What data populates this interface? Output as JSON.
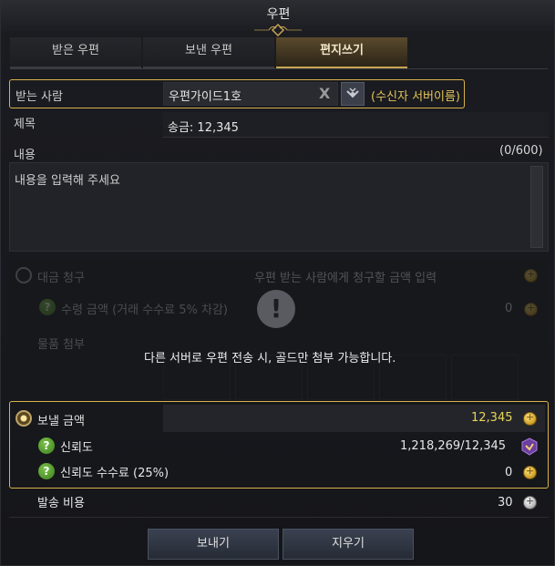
{
  "title": "우편",
  "tabs": [
    {
      "label": "받은 우편"
    },
    {
      "label": "보낸 우편"
    },
    {
      "label": "편지쓰기"
    }
  ],
  "recipient": {
    "label": "받는 사람",
    "value": "우편가이드1호",
    "clear_glyph": "X",
    "server_label": "(수신자 서버이름)"
  },
  "subject": {
    "label": "제목",
    "value": "송금: 12,345"
  },
  "content": {
    "label": "내용",
    "counter": "(0/600)",
    "placeholder": "내용을 입력해 주세요"
  },
  "cod": {
    "label": "대금 청구",
    "placeholder": "우편 받는 사람에게 청구할 금액 입력",
    "received_label": "수령 금액 (거래 수수료 5% 차감)",
    "received_value": "0"
  },
  "attach": {
    "label": "물품 첨부"
  },
  "notice": {
    "icon_glyph": "!",
    "text": "다른 서버로 우편 전송 시, 골드만 첨부 가능합니다."
  },
  "send_amount": {
    "label": "보낼 금액",
    "value": "12,345"
  },
  "trust": {
    "label": "신뢰도",
    "value": "1,218,269/12,345"
  },
  "trust_fee": {
    "label": "신뢰도 수수료 (25%)",
    "value": "0"
  },
  "shipping": {
    "label": "발송 비용",
    "value": "30"
  },
  "buttons": {
    "send": "보내기",
    "clear": "지우기"
  },
  "help_glyph": "?",
  "colors": {
    "accent_gold": "#d6b24a",
    "gold_text": "#e3c25a",
    "trust_icon": "#6b3fa0"
  }
}
